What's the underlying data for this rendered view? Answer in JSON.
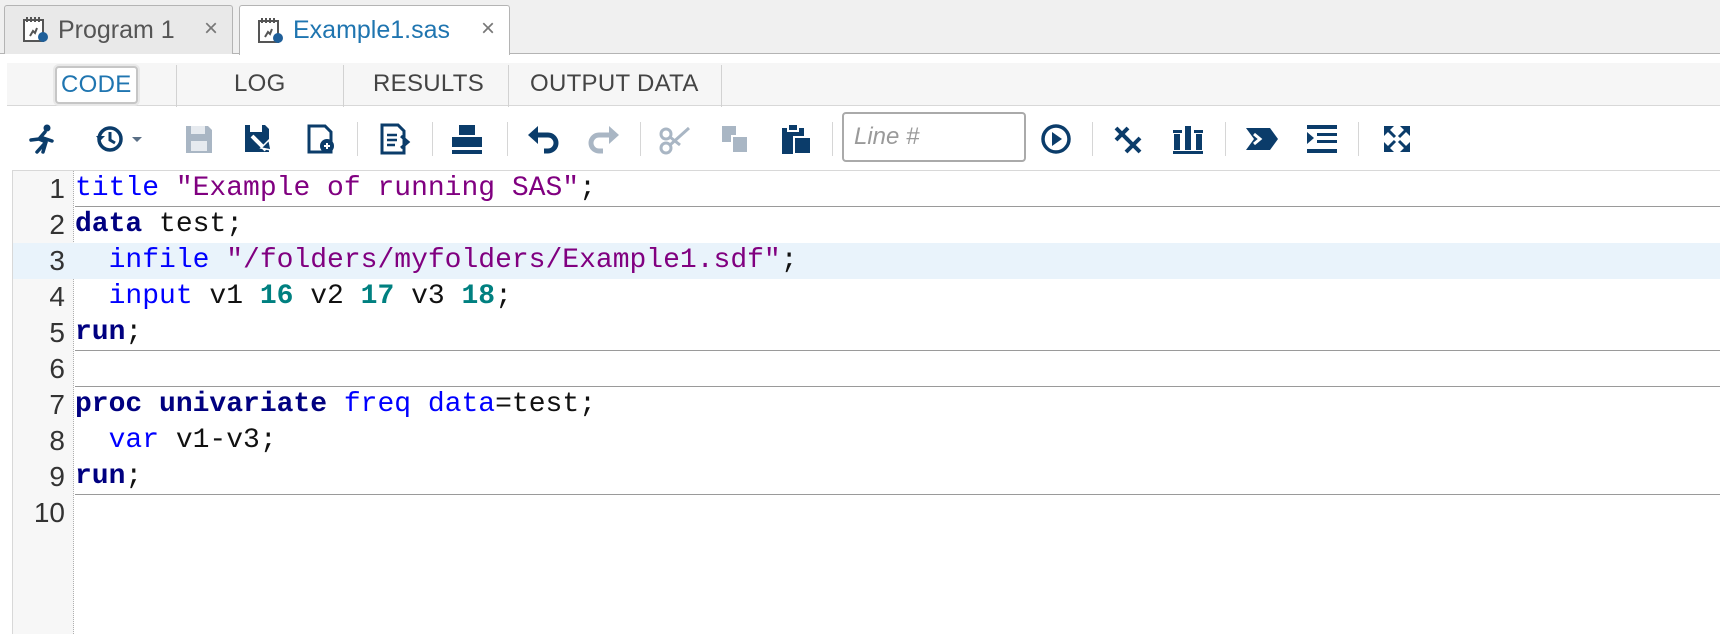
{
  "file_tabs": [
    {
      "name": "Program 1",
      "active": false,
      "icon": "sas-program-icon",
      "close": "×"
    },
    {
      "name": "Example1.sas",
      "active": true,
      "icon": "sas-program-icon",
      "close": "×"
    }
  ],
  "view_tabs": [
    "CODE",
    "LOG",
    "RESULTS",
    "OUTPUT DATA"
  ],
  "toolbar": {
    "line_placeholder": "Line #",
    "icons": [
      "run-icon",
      "history-icon",
      "save-icon",
      "save-as-icon",
      "save-copy-icon",
      "export-icon",
      "print-icon",
      "undo-icon",
      "redo-icon",
      "cut-icon",
      "copy-icon",
      "paste-icon",
      "go-to-line-icon",
      "clear-icon",
      "format-icon",
      "snippet-icon",
      "split-icon",
      "maximize-icon"
    ]
  },
  "editor": {
    "line_numbers": [
      "1",
      "2",
      "3",
      "4",
      "5",
      "6",
      "7",
      "8",
      "9",
      "10"
    ],
    "lines": [
      [
        {
          "t": "title ",
          "c": "opt"
        },
        {
          "t": "\"Example of running SAS\"",
          "c": "str"
        },
        {
          "t": ";",
          "c": "plain"
        }
      ],
      [
        {
          "t": "data",
          "c": "kw"
        },
        {
          "t": " test;",
          "c": "plain"
        }
      ],
      [
        {
          "t": "  infile ",
          "c": "opt"
        },
        {
          "t": "\"/folders/myfolders/Example1.sdf\"",
          "c": "str"
        },
        {
          "t": ";",
          "c": "plain"
        }
      ],
      [
        {
          "t": "  input",
          "c": "opt"
        },
        {
          "t": " v1 ",
          "c": "plain"
        },
        {
          "t": "16",
          "c": "num"
        },
        {
          "t": " v2 ",
          "c": "plain"
        },
        {
          "t": "17",
          "c": "num"
        },
        {
          "t": " v3 ",
          "c": "plain"
        },
        {
          "t": "18",
          "c": "num"
        },
        {
          "t": ";",
          "c": "plain"
        }
      ],
      [
        {
          "t": "run",
          "c": "kw"
        },
        {
          "t": ";",
          "c": "plain"
        }
      ],
      [],
      [
        {
          "t": "proc univariate",
          "c": "kw"
        },
        {
          "t": " ",
          "c": "plain"
        },
        {
          "t": "freq",
          "c": "opt"
        },
        {
          "t": " ",
          "c": "plain"
        },
        {
          "t": "data",
          "c": "opt"
        },
        {
          "t": "=test;",
          "c": "plain"
        }
      ],
      [
        {
          "t": "  var",
          "c": "opt"
        },
        {
          "t": " v1-v3;",
          "c": "plain"
        }
      ],
      [
        {
          "t": "run",
          "c": "kw"
        },
        {
          "t": ";",
          "c": "plain"
        }
      ],
      []
    ],
    "active_line": 3
  },
  "colors": {
    "accent": "#1f75b0",
    "keyword": "#000080",
    "string": "#800080",
    "option": "#0000ff",
    "number": "#008080"
  }
}
